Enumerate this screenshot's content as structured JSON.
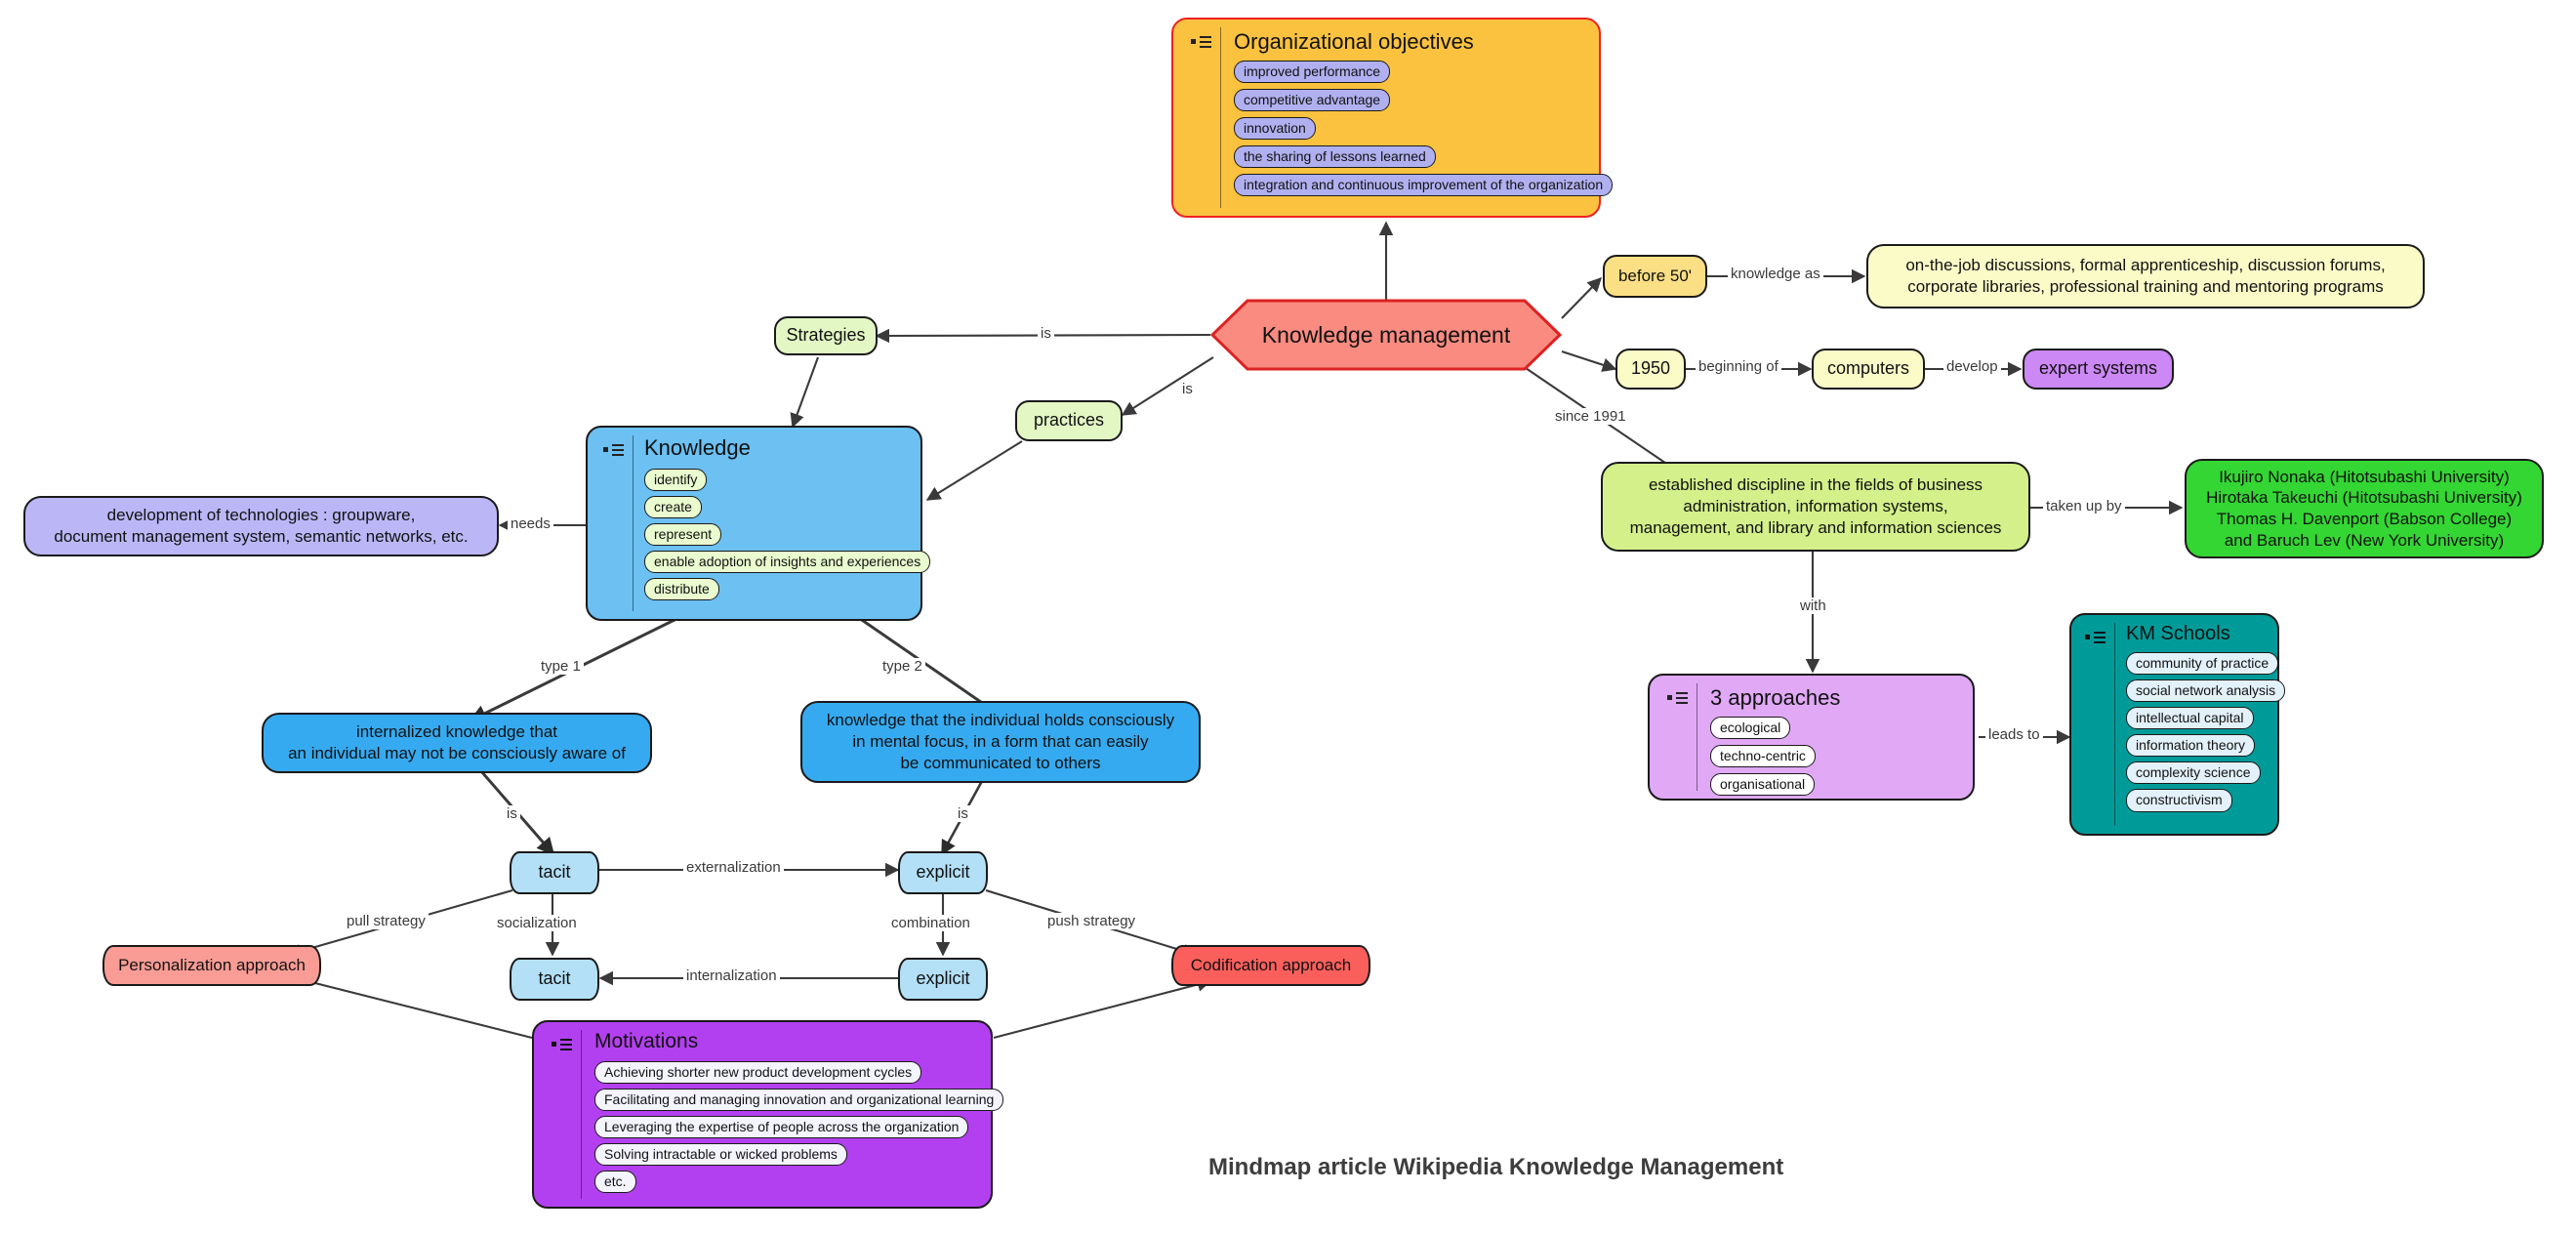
{
  "caption": "Mindmap article Wikipedia Knowledge Management",
  "colors": {
    "orange_fill": "#fbc240",
    "orange_border": "#ee2222",
    "periwinkle_pill": "#b0b0f0",
    "hexagon_fill": "#f98b80",
    "hexagon_border": "#dd2222",
    "lightgreen": "#e2f7c4",
    "lightyellow": "#fbfbc8",
    "lightyellow_deep": "#fbdf84",
    "violet": "#cc88f5",
    "green": "#d3f08a",
    "green_strong": "#33d633",
    "orchid": "#e0a8f5",
    "teal": "#009b99",
    "teal_pill": "#e3f1fb",
    "skyblue": "#6cc0f2",
    "skyblue_light": "#b3e0f7",
    "lavender": "#bbb7f7",
    "salmon": "#f99c96",
    "red": "#fb5f5c",
    "purple": "#b340f0",
    "edge": "#3a3a3a"
  },
  "center": {
    "label": "Knowledge management"
  },
  "organizational_objectives": {
    "title": "Organizational objectives",
    "items": [
      "improved performance",
      "competitive advantage",
      "innovation",
      "the sharing of lessons learned",
      "integration and continuous improvement of the organization"
    ]
  },
  "timeline": {
    "before_50": "before 50'",
    "knowledge_as_label": "knowledge as",
    "knowledge_as": "on-the-job discussions, formal apprenticeship, discussion forums,\ncorporate libraries, professional training and mentoring programs",
    "year_1950": "1950",
    "beginning_of_label": "beginning of",
    "computers": "computers",
    "develop_label": "develop",
    "expert_systems": "expert systems"
  },
  "discipline": {
    "since_label": "since 1991",
    "body": "established discipline in the fields of business\nadministration, information systems,\nmanagement, and library and information sciences",
    "taken_up_by_label": "taken up by",
    "people": "Ikujiro Nonaka (Hitotsubashi University)\nHirotaka Takeuchi (Hitotsubashi University)\nThomas H. Davenport (Babson College)\nand Baruch Lev (New York University)",
    "with_label": "with"
  },
  "approaches": {
    "title": "3 approaches",
    "items": [
      "ecological",
      "techno-centric",
      "organisational"
    ],
    "leads_to_label": "leads to"
  },
  "km_schools": {
    "title": "KM Schools",
    "items": [
      "community of practice",
      "social network analysis",
      "intellectual capital",
      "information theory",
      "complexity science",
      "constructivism"
    ]
  },
  "strategies": {
    "label": "Strategies",
    "is_label": "is"
  },
  "practices": {
    "label": "practices",
    "is_label": "is"
  },
  "knowledge": {
    "title": "Knowledge",
    "items": [
      "identify",
      "create",
      "represent",
      "enable adoption of insights and experiences",
      "distribute"
    ],
    "needs_label": "needs",
    "technologies": "development of technologies : groupware,\ndocument management system, semantic networks, etc."
  },
  "types": {
    "type1_label": "type 1",
    "type2_label": "type 2",
    "type1_body": "internalized knowledge that\nan individual may not be consciously aware of",
    "type2_body": "knowledge that the individual holds consciously\nin mental focus, in a form that can easily\nbe communicated to others",
    "is_label_left": "is",
    "is_label_right": "is"
  },
  "seci": {
    "tacit_top": "tacit",
    "explicit_top": "explicit",
    "tacit_bottom": "tacit",
    "explicit_bottom": "explicit",
    "externalization": "externalization",
    "socialization": "socialization",
    "combination": "combination",
    "internalization": "internalization",
    "pull_strategy": "pull strategy",
    "push_strategy": "push strategy",
    "personalization": "Personalization approach",
    "codification": "Codification approach"
  },
  "motivations": {
    "title": "Motivations",
    "items": [
      "Achieving shorter new product development cycles",
      "Facilitating and managing innovation and organizational learning",
      "Leveraging the expertise of people across the organization",
      "Solving intractable or wicked problems",
      "etc."
    ]
  }
}
